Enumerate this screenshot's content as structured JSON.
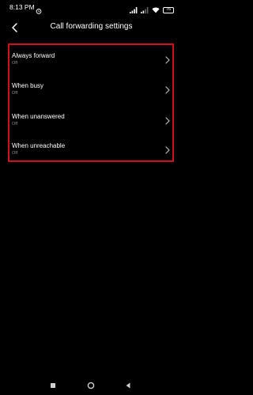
{
  "status_bar": {
    "time": "8:13 PM",
    "battery": "76",
    "icons": [
      "alarm-icon",
      "signal-icon",
      "wifi-icon",
      "battery-icon"
    ]
  },
  "header": {
    "title": "Call forwarding settings",
    "back_icon": "back-arrow-icon"
  },
  "settings": {
    "items": [
      {
        "label": "Always forward",
        "status": "Off"
      },
      {
        "label": "When busy",
        "status": "Off"
      },
      {
        "label": "When unanswered",
        "status": "Off"
      },
      {
        "label": "When unreachable",
        "status": "Off"
      }
    ]
  },
  "nav_bar": {
    "icons": [
      "recents-icon",
      "home-icon",
      "back-icon"
    ]
  },
  "colors": {
    "background": "#000000",
    "text": "#ffffff",
    "secondary_text": "#8a8a8a",
    "highlight_border": "#d0111b"
  }
}
